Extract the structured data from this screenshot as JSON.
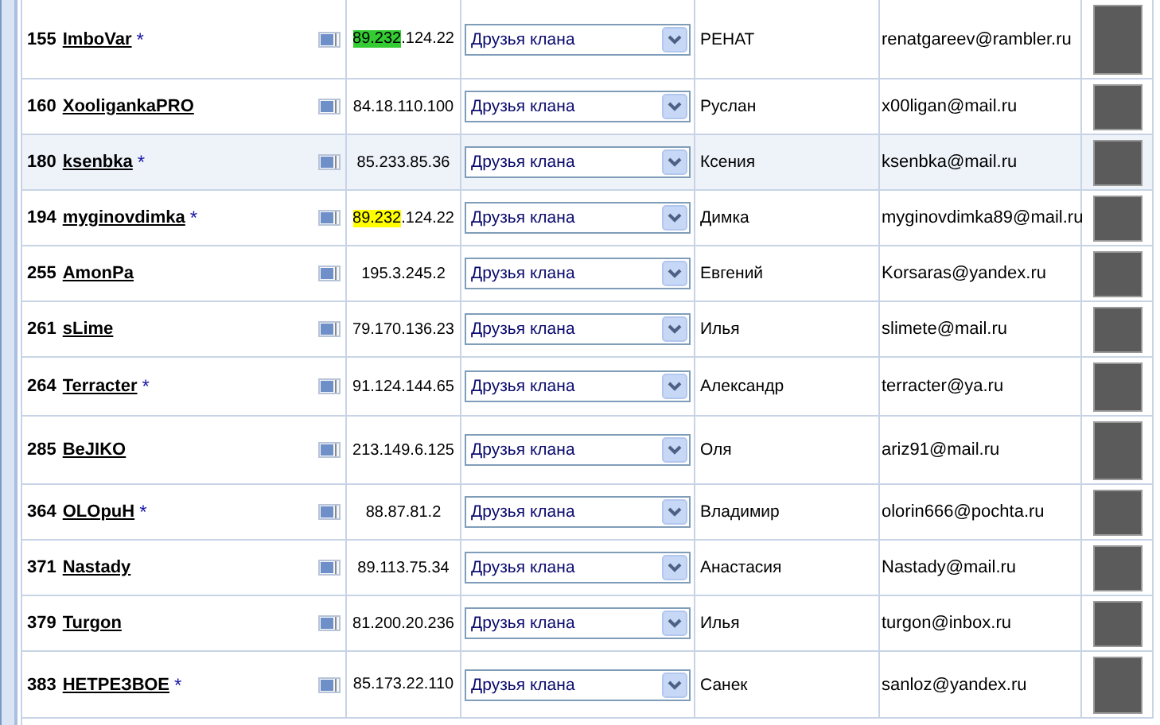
{
  "members": [
    {
      "number": "155",
      "nick": "ImboVar",
      "marker": "*",
      "ip_marked": "89.232",
      "ip_rest": ".124.22",
      "color": "#33cc33",
      "group": "Друзья клана",
      "name": "РЕНАТ",
      "email": "renatgareev@rambler.ru",
      "selected": false
    },
    {
      "number": "160",
      "nick": "XooligankaPRO",
      "ip": "84.18.110.100",
      "group": "Друзья клана",
      "name": "Руслан",
      "email": "x00ligan@mail.ru",
      "selected": false
    },
    {
      "number": "180",
      "nick": "ksenbka",
      "marker": "*",
      "ip": "85.233.85.36",
      "group": "Друзья клана",
      "name": "Ксения",
      "email": "ksenbka@mail.ru",
      "selected": true
    },
    {
      "number": "194",
      "nick": "myginovdimka",
      "marker": "*",
      "ip_marked": "89.232",
      "ip_rest": ".124.22",
      "color": "#ffff00",
      "group": "Друзья клана",
      "name": "Димка",
      "email": "myginovdimka89@mail.ru",
      "selected": false
    },
    {
      "number": "255",
      "nick": "AmonPa",
      "ip": "195.3.245.2",
      "group": "Друзья клана",
      "name": "Евгений",
      "email": "Korsaras@yandex.ru",
      "selected": false
    },
    {
      "number": "261",
      "nick": "sLime",
      "ip": "79.170.136.23",
      "group": "Друзья клана",
      "name": "Илья",
      "email": "slimete@mail.ru",
      "selected": false
    },
    {
      "number": "264",
      "nick": "Terracter",
      "marker": "*",
      "ip": "91.124.144.65",
      "group": "Друзья клана",
      "name": "Александр",
      "email": "terracter@ya.ru",
      "selected": false
    },
    {
      "number": "285",
      "nick": "BeJIKO",
      "ip": "213.149.6.125",
      "group": "Друзья клана",
      "name": "Оля",
      "email": "ariz91@mail.ru",
      "selected": false
    },
    {
      "number": "364",
      "nick": "OLOpuH",
      "marker": "*",
      "ip": "88.87.81.2",
      "group": "Друзья клана",
      "name": "Владимир",
      "email": "olorin666@pochta.ru",
      "selected": false
    },
    {
      "number": "371",
      "nick": "Nastady",
      "ip": "89.113.75.34",
      "group": "Друзья клана",
      "name": "Анастасия",
      "email": "Nastady@mail.ru",
      "selected": false
    },
    {
      "number": "379",
      "nick": "Turgon",
      "ip": "81.200.20.236",
      "group": "Друзья клана",
      "name": "Илья",
      "email": "turgon@inbox.ru",
      "selected": false
    },
    {
      "number": "383",
      "nick": "НЕТРЕЗВОЕ",
      "marker": "*",
      "ip": "85.173.22.110",
      "group": "Друзья клана",
      "name": "Санек",
      "email": "sanloz@yandex.ru",
      "selected": false
    }
  ]
}
